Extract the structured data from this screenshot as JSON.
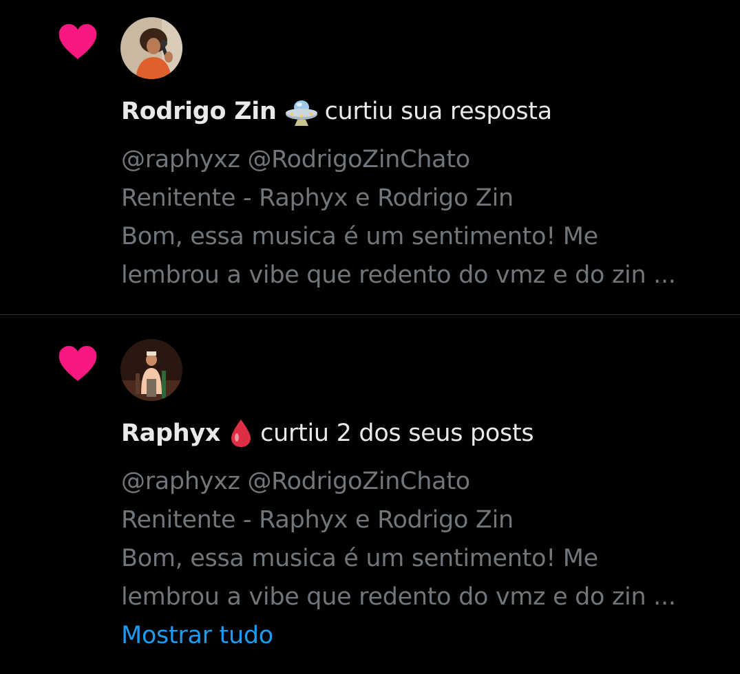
{
  "colors": {
    "background": "#000000",
    "heart": "#f91880",
    "primary_text": "#e7e9ea",
    "secondary_text": "#71767b",
    "link": "#1d9bf0",
    "divider": "#2f3336"
  },
  "notifications": [
    {
      "icon": "heart-icon",
      "user_name": "Rodrigo Zin",
      "user_emoji": "ufo-emoji",
      "action": "curtiu sua resposta",
      "preview_lines": [
        "@raphyxz @RodrigoZinChato",
        "Renitente - Raphyx e Rodrigo Zin",
        "Bom, essa musica é um sentimento! Me",
        "lembrou a vibe que redento do vmz e do zin ..."
      ]
    },
    {
      "icon": "heart-icon",
      "user_name": "Raphyx",
      "user_emoji": "drop-of-blood-emoji",
      "action": "curtiu 2 dos seus posts",
      "preview_lines": [
        "@raphyxz @RodrigoZinChato",
        "Renitente - Raphyx e Rodrigo Zin",
        "Bom, essa musica é um sentimento! Me",
        "lembrou a vibe que redento do vmz e do zin ..."
      ],
      "show_all_label": "Mostrar tudo"
    }
  ]
}
